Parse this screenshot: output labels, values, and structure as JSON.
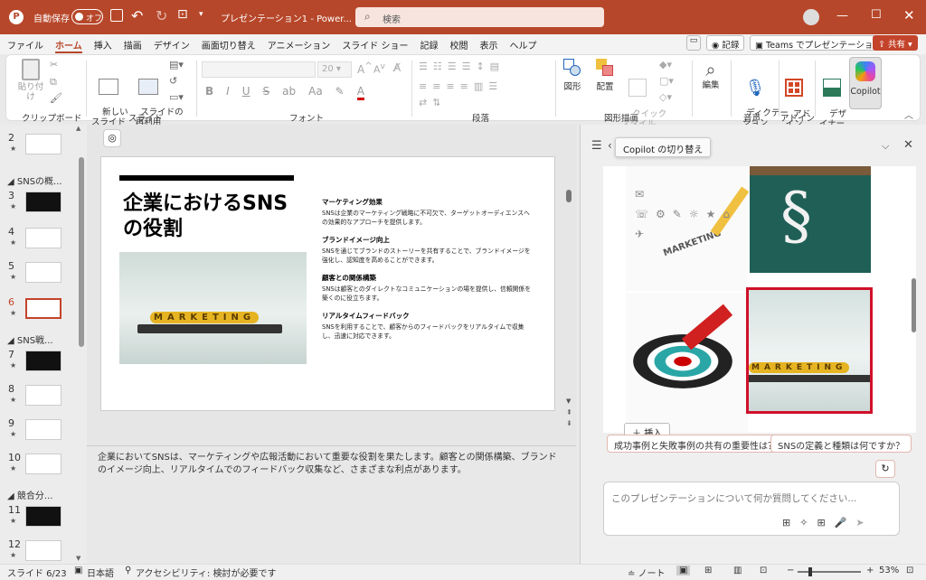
{
  "titlebar": {
    "autosave_label": "自動保存",
    "autosave_state": "オフ",
    "doc_title": "プレゼンテーション1 - Power...",
    "search_placeholder": "検索"
  },
  "menu": [
    "ファイル",
    "ホーム",
    "挿入",
    "描画",
    "デザイン",
    "画面切り替え",
    "アニメーション",
    "スライド ショー",
    "記録",
    "校閲",
    "表示",
    "ヘルプ"
  ],
  "menu_right": {
    "record": "記録",
    "teams": "Teams でプレゼンテーション",
    "share": "共有"
  },
  "ribbon": {
    "paste": "貼り付け",
    "clipboard": "クリップボード",
    "new_slide": "新しい\nスライド",
    "reuse_slide": "スライドの\n再利用",
    "slides": "スライド",
    "font_size": "20",
    "font": "フォント",
    "paragraph": "段落",
    "shapes": "図形",
    "arrange": "配置",
    "quick_style": "クイック\nスタイル",
    "drawing": "図形描画",
    "edit": "編集",
    "dictate": "ディクテー\nション",
    "voice": "音声",
    "addin": "アド\nイン",
    "addins": "アドイン",
    "designer": "デザ\nイナー",
    "copilot": "Copilot"
  },
  "thumbs": {
    "items": [
      {
        "num": "2"
      },
      {
        "num": "3"
      },
      {
        "num": "4"
      },
      {
        "num": "5"
      },
      {
        "num": "6"
      },
      {
        "num": "7"
      },
      {
        "num": "8"
      },
      {
        "num": "9"
      },
      {
        "num": "10"
      },
      {
        "num": "11"
      },
      {
        "num": "12"
      }
    ],
    "sections": [
      "SNSの概...",
      "SNS戦...",
      "競合分..."
    ]
  },
  "slide": {
    "title": "企業におけるSNSの役割",
    "marketing_text": "MARKETING",
    "points": [
      {
        "h": "マーケティング効果",
        "b": "SNSは企業のマーケティング戦略に不可欠で、ターゲットオーディエンスへの効果的なアプローチを提供します。"
      },
      {
        "h": "ブランドイメージ向上",
        "b": "SNSを通じてブランドのストーリーを共有することで、ブランドイメージを強化し、認知度を高めることができます。"
      },
      {
        "h": "顧客との関係構築",
        "b": "SNSは顧客とのダイレクトなコミュニケーションの場を提供し、信頼関係を築くのに役立ちます。"
      },
      {
        "h": "リアルタイムフィードバック",
        "b": "SNSを利用することで、顧客からのフィードバックをリアルタイムで収集し、迅速に対応できます。"
      }
    ]
  },
  "notes": "企業においてSNSは、マーケティングや広報活動において重要な役割を果たします。顧客との関係構築、ブランドのイメージ向上、リアルタイムでのフィードバック収集など、さまざまな利点があります。",
  "copilot": {
    "tooltip": "Copilot の切り替え",
    "insert": "挿入",
    "marketing_text": "MARKETING",
    "suggest1": "成功事例と失敗事例の共有の重要性は？",
    "suggest2": "SNSの定義と種類は何ですか？",
    "input_placeholder": "このプレゼンテーションについて何か質問してください..."
  },
  "status": {
    "slide": "スライド 6/23",
    "lang": "日本語",
    "access": "アクセシビリティ: 検討が必要です",
    "notes": "ノート",
    "zoom": "53%"
  }
}
